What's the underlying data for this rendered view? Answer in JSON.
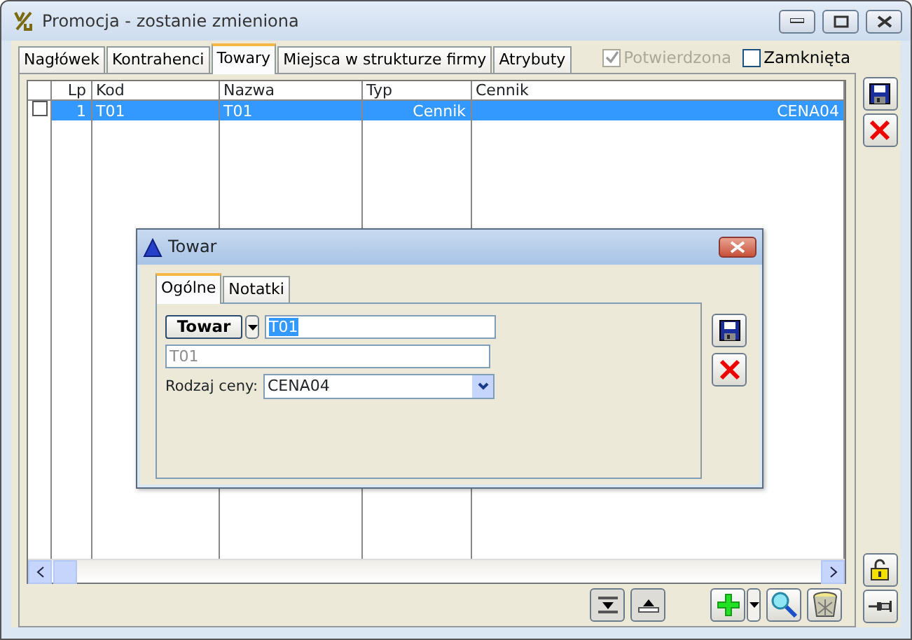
{
  "window": {
    "title": "Promocja - zostanie zmieniona"
  },
  "tabs": [
    {
      "label": "Nagłówek",
      "selected": false
    },
    {
      "label": "Kontrahenci",
      "selected": false
    },
    {
      "label": "Towary",
      "selected": true
    },
    {
      "label": "Miejsca w strukturze firmy",
      "selected": false
    },
    {
      "label": "Atrybuty",
      "selected": false
    }
  ],
  "flags": [
    {
      "label": "Potwierdzona",
      "checked": true,
      "disabled": true
    },
    {
      "label": "Zamknięta",
      "checked": false,
      "disabled": false
    }
  ],
  "table": {
    "columns": [
      "Lp",
      "Kod",
      "Nazwa",
      "Typ",
      "Cennik"
    ],
    "rows": [
      {
        "checked": false,
        "selected": true,
        "cells": [
          "1",
          "T01",
          "T01",
          "Cennik",
          "CENA04"
        ]
      }
    ]
  },
  "dialog": {
    "title": "Towar",
    "tabs": [
      {
        "label": "Ogólne",
        "selected": true
      },
      {
        "label": "Notatki",
        "selected": false
      }
    ],
    "item_button": "Towar",
    "code": "T01",
    "name": "T01",
    "price_label": "Rodzaj ceny:",
    "price_value": "CENA04"
  }
}
